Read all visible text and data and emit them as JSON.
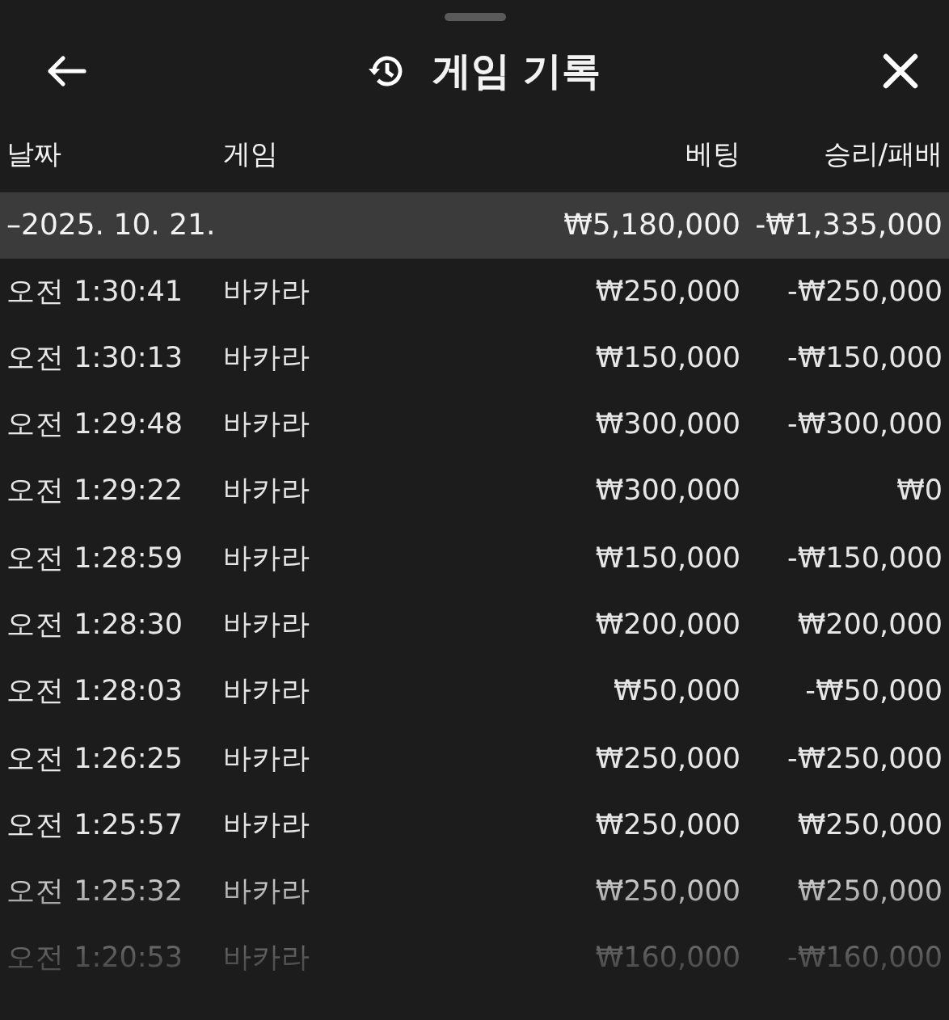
{
  "header": {
    "title": "게임 기록"
  },
  "columns": [
    "날짜",
    "게임",
    "베팅",
    "승리/패배"
  ],
  "group": {
    "date": "–2025. 10. 21.",
    "bet": "₩5,180,000",
    "result": "-₩1,335,000"
  },
  "rows": [
    {
      "time": "오전 1:30:41",
      "game": "바카라",
      "bet": "₩250,000",
      "result": "-₩250,000"
    },
    {
      "time": "오전 1:30:13",
      "game": "바카라",
      "bet": "₩150,000",
      "result": "-₩150,000"
    },
    {
      "time": "오전 1:29:48",
      "game": "바카라",
      "bet": "₩300,000",
      "result": "-₩300,000"
    },
    {
      "time": "오전 1:29:22",
      "game": "바카라",
      "bet": "₩300,000",
      "result": "₩0"
    },
    {
      "time": "오전 1:28:59",
      "game": "바카라",
      "bet": "₩150,000",
      "result": "-₩150,000"
    },
    {
      "time": "오전 1:28:30",
      "game": "바카라",
      "bet": "₩200,000",
      "result": "₩200,000"
    },
    {
      "time": "오전 1:28:03",
      "game": "바카라",
      "bet": "₩50,000",
      "result": "-₩50,000"
    },
    {
      "time": "오전 1:26:25",
      "game": "바카라",
      "bet": "₩250,000",
      "result": "-₩250,000"
    },
    {
      "time": "오전 1:25:57",
      "game": "바카라",
      "bet": "₩250,000",
      "result": "₩250,000"
    },
    {
      "time": "오전 1:25:32",
      "game": "바카라",
      "bet": "₩250,000",
      "result": "₩250,000"
    },
    {
      "time": "오전 1:20:53",
      "game": "바카라",
      "bet": "₩160,000",
      "result": "-₩160,000"
    }
  ]
}
